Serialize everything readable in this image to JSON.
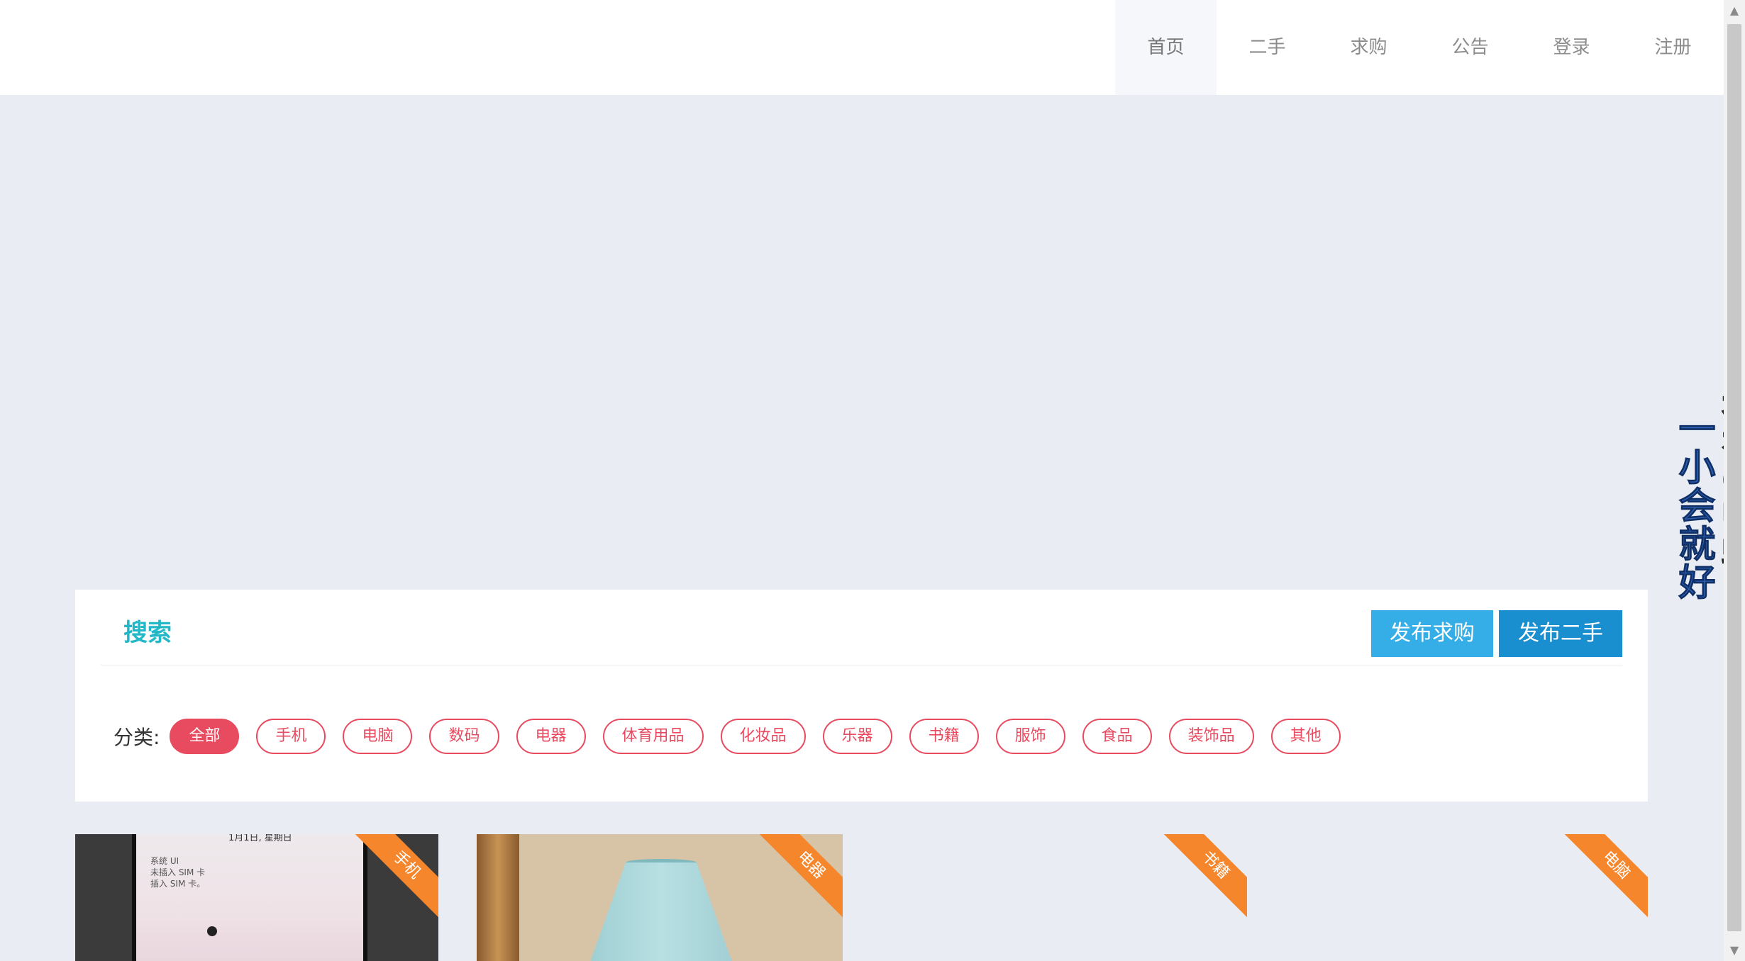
{
  "nav": {
    "items": [
      {
        "label": "首页",
        "active": true
      },
      {
        "label": "二手",
        "active": false
      },
      {
        "label": "求购",
        "active": false
      },
      {
        "label": "公告",
        "active": false
      },
      {
        "label": "登录",
        "active": false
      },
      {
        "label": "注册",
        "active": false
      }
    ]
  },
  "overlay": {
    "chinese_text": "一小会就好",
    "korean_text": "잠깐이면돼"
  },
  "search_panel": {
    "title": "搜索",
    "btn_want": "发布求购",
    "btn_sell": "发布二手",
    "category_label": "分类:",
    "categories": [
      {
        "label": "全部",
        "active": true
      },
      {
        "label": "手机",
        "active": false
      },
      {
        "label": "电脑",
        "active": false
      },
      {
        "label": "数码",
        "active": false
      },
      {
        "label": "电器",
        "active": false
      },
      {
        "label": "体育用品",
        "active": false
      },
      {
        "label": "化妆品",
        "active": false
      },
      {
        "label": "乐器",
        "active": false
      },
      {
        "label": "书籍",
        "active": false
      },
      {
        "label": "服饰",
        "active": false
      },
      {
        "label": "食品",
        "active": false
      },
      {
        "label": "装饰品",
        "active": false
      },
      {
        "label": "其他",
        "active": false
      }
    ]
  },
  "cards": [
    {
      "tag": "手机",
      "phone_date": "1月1日, 星期日",
      "phone_notice_1": "系统 UI",
      "phone_notice_2": "未插入 SIM 卡",
      "phone_notice_3": "插入 SIM 卡。"
    },
    {
      "tag": "电器"
    },
    {
      "tag": "书籍"
    },
    {
      "tag": "电脑"
    }
  ],
  "colors": {
    "accent_title": "#22b8c8",
    "category_red": "#e84a5f",
    "button_light_blue": "#35aee8",
    "button_blue": "#1a8fd0",
    "ribbon_orange": "#f5862b",
    "page_bg": "#e9ecf3"
  }
}
